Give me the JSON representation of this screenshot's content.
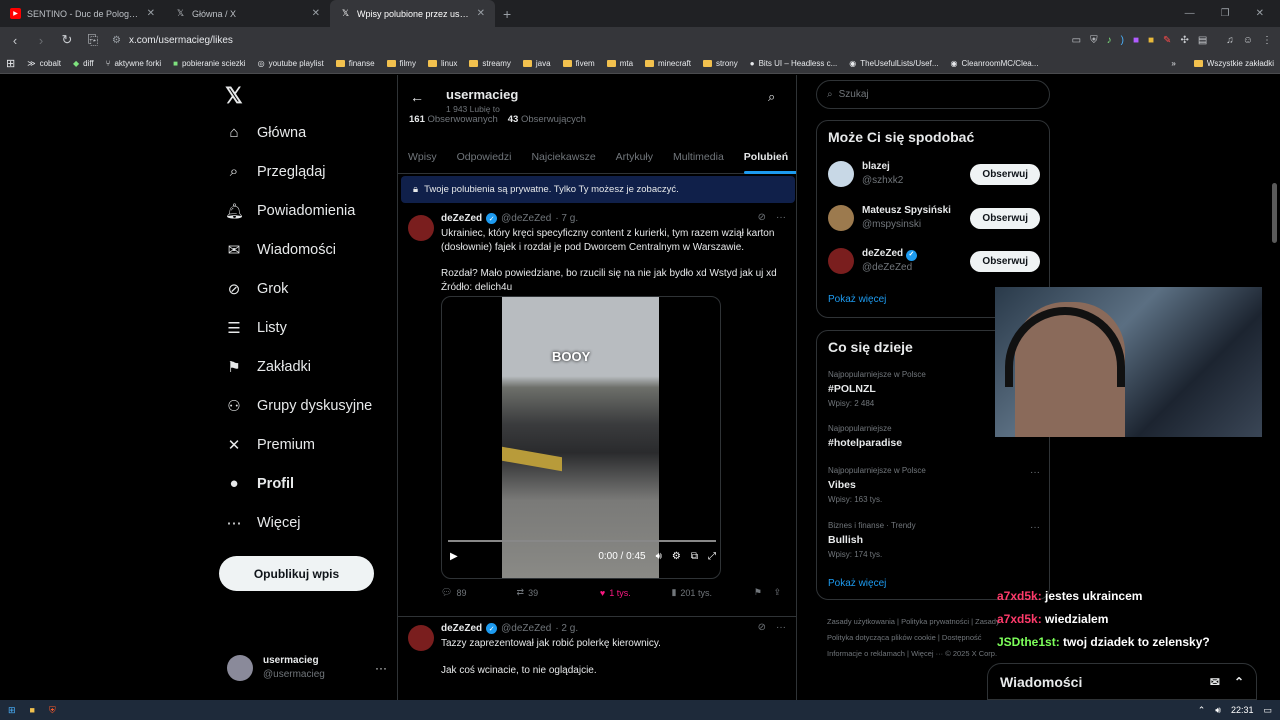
{
  "browser": {
    "tabs": [
      {
        "title": "SENTINO - Duc de Pologne (prod",
        "icon": "youtube-icon"
      },
      {
        "title": "Główna / X",
        "icon": "x-icon"
      },
      {
        "title": "Wpisy polubione przez usermac",
        "icon": "x-icon"
      }
    ],
    "url": "x.com/usermacieg/likes",
    "bookmarks": [
      "cobalt",
      "diff",
      "aktywne forki",
      "pobieranie sciezki",
      "youtube playlist",
      "finanse",
      "filmy",
      "linux",
      "streamy",
      "java",
      "fivem",
      "mta",
      "minecraft",
      "strony",
      "Bits UI – Headless c...",
      "TheUsefulLists/Usef...",
      "CleanroomMC/Clea..."
    ],
    "all_bookmarks": "Wszystkie zakładki"
  },
  "leftnav": {
    "items": [
      {
        "label": "Główna",
        "icon": "home-icon",
        "glyph": "⌂"
      },
      {
        "label": "Przeglądaj",
        "icon": "search-icon",
        "glyph": "⌕"
      },
      {
        "label": "Powiadomienia",
        "icon": "bell-icon",
        "glyph": "♫"
      },
      {
        "label": "Wiadomości",
        "icon": "mail-icon",
        "glyph": "✉"
      },
      {
        "label": "Grok",
        "icon": "grok-icon",
        "glyph": "⊘"
      },
      {
        "label": "Listy",
        "icon": "list-icon",
        "glyph": "☰"
      },
      {
        "label": "Zakładki",
        "icon": "bookmark-icon",
        "glyph": "⎘"
      },
      {
        "label": "Grupy dyskusyjne",
        "icon": "groups-icon",
        "glyph": "⚇"
      },
      {
        "label": "Premium",
        "icon": "x-premium-icon",
        "glyph": "✕"
      },
      {
        "label": "Profil",
        "icon": "profile-icon",
        "glyph": "●"
      },
      {
        "label": "Więcej",
        "icon": "more-icon",
        "glyph": "⋯"
      }
    ],
    "post_button": "Opublikuj wpis",
    "account": {
      "name": "usermacieg",
      "handle": "@usermacieg"
    }
  },
  "profile": {
    "name": "usermacieg",
    "likes": "1 943 Lubię to",
    "following_count": "161",
    "following_label": "Obserwowanych",
    "followers_count": "43",
    "followers_label": "Obserwujących",
    "tabs": [
      "Wpisy",
      "Odpowiedzi",
      "Najciekawsze",
      "Artykuły",
      "Multimedia",
      "Polubień"
    ],
    "notice": "Twoje polubienia są prywatne. Tylko Ty możesz je zobaczyć."
  },
  "tweets": [
    {
      "name": "deZeZed",
      "handle": "@deZeZed",
      "time": "· 7 g.",
      "text1": "Ukrainiec, który kręci specyficzny content z kurierki, tym razem wziął karton (dosłownie) fajek i rozdał je pod Dworcem Centralnym w Warszawie.",
      "text2": "Rozdał? Mało powiedziane, bo rzucili się na nie jak bydło xd Wstyd jak uj xd",
      "text3": "Źródło: delich4u",
      "video_caption": "BOOY",
      "video_time": "0:00 / 0:45",
      "video_progress": 0,
      "replies": "89",
      "reposts": "39",
      "likes": "1 tys.",
      "views": "201 tys."
    },
    {
      "name": "deZeZed",
      "handle": "@deZeZed",
      "time": "· 2 g.",
      "text1": "Tazzy zaprezentował jak robić polerkę kierownicy.",
      "text2": "Jak coś wcinacie, to nie oglądajcie."
    }
  ],
  "sidebar": {
    "search_placeholder": "Szukaj",
    "who_title": "Może Ci się spodobać",
    "who": [
      {
        "name": "blazej",
        "handle": "@szhxk2",
        "button": "Obserwuj",
        "verified": false
      },
      {
        "name": "Mateusz Spysiński",
        "handle": "@mspysinski",
        "button": "Obserwuj",
        "verified": false
      },
      {
        "name": "deZeZed",
        "handle": "@deZeZed",
        "button": "Obserwuj",
        "verified": true
      }
    ],
    "show_more": "Pokaż więcej",
    "trends_title": "Co się dzieje",
    "trends": [
      {
        "context": "Najpopularniejsze w Polsce",
        "name": "#POLNZL",
        "posts": "Wpisy: 2 484"
      },
      {
        "context": "Najpopularniejsze",
        "name": "#hotelparadise",
        "posts": ""
      },
      {
        "context": "Najpopularniejsze w Polsce",
        "name": "Vibes",
        "posts": "Wpisy: 163 tys."
      },
      {
        "context": "Biznes i finanse · Trendy",
        "name": "Bullish",
        "posts": "Wpisy: 174 tys."
      }
    ],
    "footer_line1": "Zasady użytkowania   |   Polityka prywatności   |   Zasady",
    "footer_line2": "Polityka dotycząca plików cookie   |   Dostępność",
    "footer_line3": "Informacje o reklamach   |   Więcej ···   © 2025 X Corp."
  },
  "chat": [
    {
      "user": "a7xd5k:",
      "msg": "jestes ukraincem"
    },
    {
      "user": "a7xd5k:",
      "msg": "wiedzialem"
    },
    {
      "user": "JSDthe1st:",
      "msg": "twoj dziadek to zelensky?"
    }
  ],
  "dm": {
    "title": "Wiadomości"
  },
  "taskbar": {
    "clock": "22:31"
  },
  "colors": {
    "accent": "#1d9bf0",
    "like": "#f91880",
    "background": "#000000"
  }
}
